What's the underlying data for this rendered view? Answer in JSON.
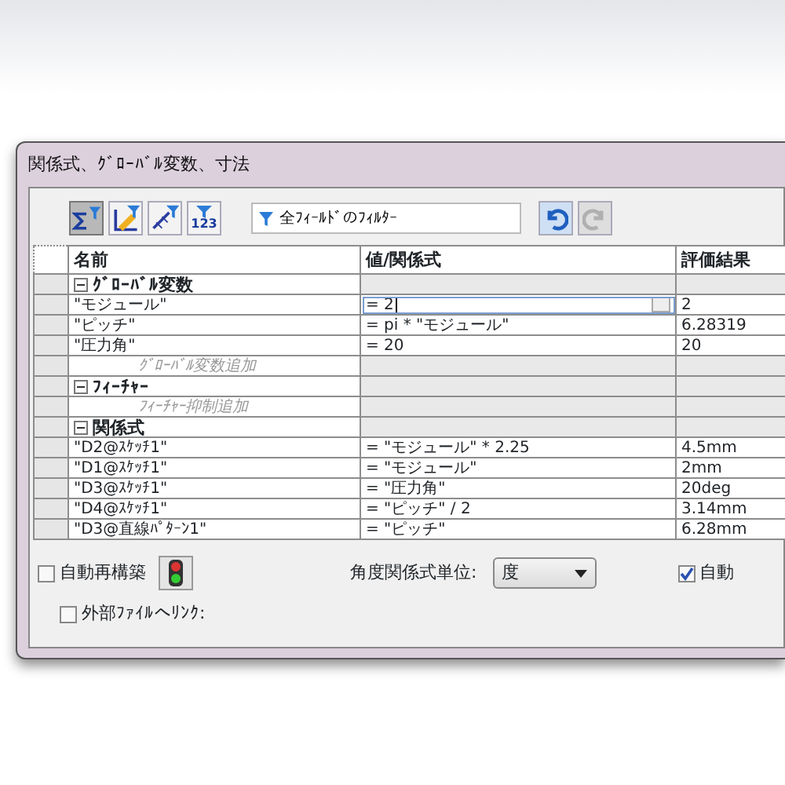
{
  "window": {
    "title": "関係式、ｸﾞﾛｰﾊﾞﾙ変数、寸法"
  },
  "toolbar": {
    "filters": [
      {
        "kind": "sigma",
        "selected": true
      },
      {
        "kind": "pencil",
        "selected": false
      },
      {
        "kind": "dimension",
        "selected": false
      },
      {
        "kind": "numeric",
        "label": "123",
        "selected": false
      }
    ],
    "filter_field": {
      "placeholder": "全ﾌｨｰﾙﾄﾞのﾌｨﾙﾀｰ"
    },
    "undo": {
      "disabled": false
    },
    "redo": {
      "disabled": true
    }
  },
  "table": {
    "columns": [
      "名前",
      "値/関係式",
      "評価結果"
    ],
    "groups": [
      {
        "name": "ｸﾞﾛｰﾊﾞﾙ変数",
        "expanded": true,
        "children": [
          {
            "kind": "item",
            "name": "\"モジュール\"",
            "value": "= 2",
            "result": "2",
            "editing": true
          },
          {
            "kind": "item",
            "name": "\"ピッチ\"",
            "value": "= pi * \"モジュール\"",
            "result": "6.28319",
            "editing": false
          },
          {
            "kind": "item",
            "name": "\"圧力角\"",
            "value": "= 20",
            "result": "20",
            "editing": false
          },
          {
            "kind": "add",
            "name": "ｸﾞﾛｰﾊﾞﾙ変数追加"
          }
        ]
      },
      {
        "name": "ﾌｨｰﾁｬｰ",
        "expanded": true,
        "children": [
          {
            "kind": "add",
            "name": "ﾌｨｰﾁｬｰ抑制追加"
          }
        ]
      },
      {
        "name": "関係式",
        "expanded": true,
        "children": [
          {
            "kind": "item",
            "name": "\"D2@ｽｹｯﾁ1\"",
            "value": "= \"モジュール\" * 2.25",
            "result": "4.5mm",
            "editing": false
          },
          {
            "kind": "item",
            "name": "\"D1@ｽｹｯﾁ1\"",
            "value": "= \"モジュール\"",
            "result": "2mm",
            "editing": false
          },
          {
            "kind": "item",
            "name": "\"D3@ｽｹｯﾁ1\"",
            "value": "= \"圧力角\"",
            "result": "20deg",
            "editing": false
          },
          {
            "kind": "item",
            "name": "\"D4@ｽｹｯﾁ1\"",
            "value": "= \"ピッチ\" / 2",
            "result": "3.14mm",
            "editing": false
          },
          {
            "kind": "item",
            "name": "\"D3@直線ﾊﾟﾀｰﾝ1\"",
            "value": "= \"ピッチ\"",
            "result": "6.28mm",
            "editing": false
          }
        ]
      }
    ]
  },
  "options": {
    "auto_rebuild": {
      "label": "自動再構築",
      "checked": false
    },
    "angle_units": {
      "label": "角度関係式単位:",
      "value": "度"
    },
    "auto_other": {
      "label": "自動",
      "checked": true
    },
    "link_external": {
      "label": "外部ﾌｧｲﾙへﾘﾝｸ:",
      "checked": false
    }
  }
}
